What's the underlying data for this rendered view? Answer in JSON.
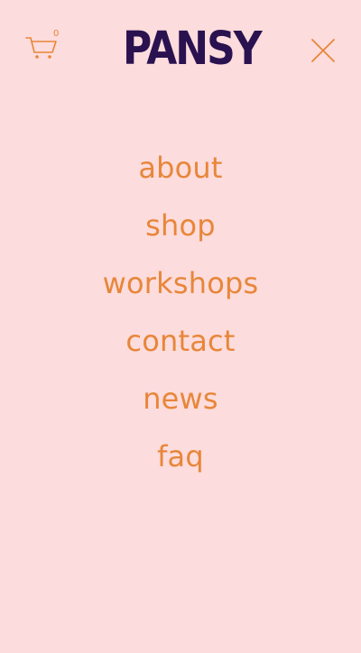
{
  "header": {
    "cart": {
      "icon": "cart-icon",
      "count": "0"
    },
    "logo": {
      "text": "PANSY"
    },
    "close": {
      "icon": "close-icon"
    }
  },
  "menu": {
    "items": [
      {
        "label": "about"
      },
      {
        "label": "shop"
      },
      {
        "label": "workshops"
      },
      {
        "label": "contact"
      },
      {
        "label": "news"
      },
      {
        "label": "faq"
      }
    ]
  },
  "colors": {
    "background": "#fcdcdc",
    "accent": "#e8863a",
    "brand": "#2a1250"
  }
}
